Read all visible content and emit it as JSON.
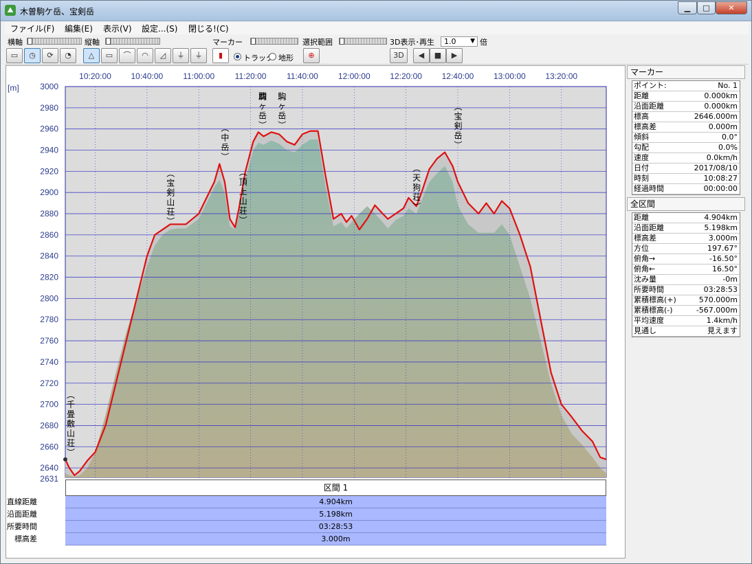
{
  "window": {
    "title": "木曽駒ケ岳、宝剣岳",
    "min": "▁",
    "max": "□",
    "close": "✕"
  },
  "menu": [
    "ファイル(F)",
    "編集(E)",
    "表示(V)",
    "設定...(S)",
    "閉じる!(C)"
  ],
  "toolbar": {
    "horizontal_label": "横軸",
    "vertical_label": "縦軸",
    "marker_label": "マーカー",
    "track_label": "トラック",
    "terrain_label": "地形",
    "selection_label": "選択範囲",
    "play3d_label": "3D表示･再生",
    "zoom_value": "1.0",
    "zoom_unit": "倍"
  },
  "chart_data": {
    "type": "area",
    "ylabel": "[m]",
    "ylim": [
      2631,
      3000
    ],
    "y_ticks": [
      3000,
      2980,
      2960,
      2940,
      2920,
      2900,
      2880,
      2860,
      2840,
      2820,
      2800,
      2780,
      2760,
      2740,
      2720,
      2700,
      2680,
      2660,
      2640,
      2631
    ],
    "x_ticks": [
      "10:20:00",
      "10:40:00",
      "11:00:00",
      "11:20:00",
      "11:40:00",
      "12:00:00",
      "12:20:00",
      "12:40:00",
      "13:00:00",
      "13:20:00"
    ],
    "xlim": [
      "10:08:27",
      "13:37:20"
    ],
    "series": [
      {
        "role": "track",
        "color": "#e01010",
        "x": [
          "10:08:27",
          "10:10:00",
          "10:12:00",
          "10:14:00",
          "10:17:00",
          "10:20:00",
          "10:24:00",
          "10:28:00",
          "10:32:00",
          "10:36:00",
          "10:40:00",
          "10:43:00",
          "10:46:00",
          "10:49:00",
          "10:52:00",
          "10:55:00",
          "11:00:00",
          "11:03:00",
          "11:06:00",
          "11:08:00",
          "11:10:00",
          "11:12:00",
          "11:14:00",
          "11:15:30",
          "11:18:00",
          "11:21:00",
          "11:23:00",
          "11:25:00",
          "11:28:00",
          "11:31:00",
          "11:34:00",
          "11:37:00",
          "11:40:00",
          "11:43:00",
          "11:46:00",
          "11:49:00",
          "11:52:00",
          "11:55:00",
          "11:57:00",
          "11:59:00",
          "12:02:00",
          "12:05:00",
          "12:08:00",
          "12:11:00",
          "12:13:00",
          "12:16:00",
          "12:19:00",
          "12:21:00",
          "12:24:00",
          "12:26:00",
          "12:29:00",
          "12:32:00",
          "12:35:00",
          "12:38:00",
          "12:40:00",
          "12:44:00",
          "12:48:00",
          "12:51:00",
          "12:54:00",
          "12:57:00",
          "13:00:00",
          "13:04:00",
          "13:08:00",
          "13:12:00",
          "13:16:00",
          "13:20:00",
          "13:24:00",
          "13:28:00",
          "13:32:00",
          "13:35:00",
          "13:37:20"
        ],
        "y": [
          2648,
          2640,
          2633,
          2637,
          2647,
          2655,
          2680,
          2720,
          2760,
          2800,
          2840,
          2860,
          2865,
          2870,
          2870,
          2870,
          2880,
          2895,
          2910,
          2927,
          2910,
          2875,
          2867,
          2885,
          2920,
          2948,
          2957,
          2953,
          2957,
          2955,
          2948,
          2945,
          2955,
          2958,
          2958,
          2915,
          2875,
          2880,
          2872,
          2878,
          2865,
          2875,
          2888,
          2880,
          2875,
          2880,
          2885,
          2895,
          2887,
          2900,
          2922,
          2932,
          2938,
          2925,
          2910,
          2890,
          2880,
          2890,
          2880,
          2892,
          2885,
          2860,
          2830,
          2780,
          2730,
          2700,
          2688,
          2675,
          2665,
          2650,
          2648
        ]
      },
      {
        "role": "terrain",
        "color": "#8fb8a8",
        "x": [
          "10:08:27",
          "10:10:00",
          "10:12:00",
          "10:14:00",
          "10:17:00",
          "10:20:00",
          "10:24:00",
          "10:28:00",
          "10:32:00",
          "10:36:00",
          "10:40:00",
          "10:43:00",
          "10:46:00",
          "10:49:00",
          "10:52:00",
          "10:55:00",
          "11:00:00",
          "11:03:00",
          "11:06:00",
          "11:08:00",
          "11:10:00",
          "11:12:00",
          "11:14:00",
          "11:15:30",
          "11:18:00",
          "11:21:00",
          "11:23:00",
          "11:25:00",
          "11:28:00",
          "11:31:00",
          "11:34:00",
          "11:37:00",
          "11:40:00",
          "11:43:00",
          "11:46:00",
          "11:49:00",
          "11:52:00",
          "11:55:00",
          "11:57:00",
          "11:59:00",
          "12:02:00",
          "12:05:00",
          "12:08:00",
          "12:11:00",
          "12:13:00",
          "12:16:00",
          "12:19:00",
          "12:21:00",
          "12:24:00",
          "12:26:00",
          "12:29:00",
          "12:32:00",
          "12:35:00",
          "12:38:00",
          "12:40:00",
          "12:44:00",
          "12:48:00",
          "12:51:00",
          "12:54:00",
          "12:57:00",
          "13:00:00",
          "13:04:00",
          "13:08:00",
          "13:12:00",
          "13:16:00",
          "13:20:00",
          "13:24:00",
          "13:28:00",
          "13:32:00",
          "13:35:00",
          "13:37:20"
        ],
        "y": [
          2635,
          2633,
          2632,
          2633,
          2640,
          2655,
          2690,
          2730,
          2768,
          2800,
          2830,
          2850,
          2860,
          2865,
          2866,
          2866,
          2875,
          2890,
          2905,
          2912,
          2900,
          2868,
          2865,
          2880,
          2912,
          2940,
          2947,
          2945,
          2949,
          2946,
          2940,
          2938,
          2945,
          2950,
          2950,
          2905,
          2868,
          2872,
          2866,
          2872,
          2880,
          2887,
          2880,
          2872,
          2866,
          2874,
          2878,
          2885,
          2880,
          2892,
          2910,
          2918,
          2925,
          2910,
          2888,
          2870,
          2862,
          2862,
          2862,
          2870,
          2860,
          2830,
          2800,
          2760,
          2720,
          2690,
          2672,
          2662,
          2650,
          2640,
          2635
        ]
      }
    ],
    "annotations": [
      {
        "text": "(千畳敷山荘)",
        "x": "10:08:27",
        "y": 2648
      },
      {
        "text": "(宝剣山荘)",
        "x": "10:47:00",
        "y": 2866
      },
      {
        "text": "(中岳)",
        "x": "11:08:00",
        "y": 2927
      },
      {
        "text": "(頂上山荘)",
        "x": "11:15:00",
        "y": 2867
      },
      {
        "text": "(西駒ヶ岳)",
        "x": "11:22:30",
        "y": 2957
      },
      {
        "text": "(駒ヶ岳)",
        "x": "11:30:00",
        "y": 2957
      },
      {
        "text": "(天狗荘)",
        "x": "12:22:00",
        "y": 2880
      },
      {
        "text": "(宝剣岳)",
        "x": "12:38:00",
        "y": 2938
      }
    ],
    "grid": true
  },
  "stats": {
    "header": "区間 1",
    "rows": [
      {
        "label": "直線距離",
        "value": "4.904km"
      },
      {
        "label": "沿面距離",
        "value": "5.198km"
      },
      {
        "label": "所要時間",
        "value": "03:28:53"
      },
      {
        "label": "標高差",
        "value": "3.000m"
      }
    ]
  },
  "marker_panel": {
    "title": "マーカー",
    "rows": [
      {
        "k": "ポイント:",
        "v": "No. 1"
      },
      {
        "k": "距離",
        "v": "0.000km"
      },
      {
        "k": "沿面距離",
        "v": "0.000km"
      },
      {
        "k": "標高",
        "v": "2646.000m"
      },
      {
        "k": "標高差",
        "v": "0.000m"
      },
      {
        "k": "傾斜",
        "v": "0.0°"
      },
      {
        "k": "勾配",
        "v": "0.0%"
      },
      {
        "k": "速度",
        "v": "0.0km/h"
      },
      {
        "k": "日付",
        "v": "2017/08/10"
      },
      {
        "k": "時刻",
        "v": "10:08:27"
      },
      {
        "k": "経過時間",
        "v": "00:00:00"
      }
    ]
  },
  "total_panel": {
    "title": "全区間",
    "rows": [
      {
        "k": "距離",
        "v": "4.904km"
      },
      {
        "k": "沿面距離",
        "v": "5.198km"
      },
      {
        "k": "標高差",
        "v": "3.000m"
      },
      {
        "k": "方位",
        "v": "197.67°"
      },
      {
        "k": "俯角→",
        "v": "-16.50°"
      },
      {
        "k": "俯角←",
        "v": "16.50°"
      },
      {
        "k": "沈み量",
        "v": "-0m"
      },
      {
        "k": "所要時間",
        "v": "03:28:53"
      },
      {
        "k": "累積標高(+)",
        "v": "570.000m"
      },
      {
        "k": "累積標高(-)",
        "v": "-567.000m"
      },
      {
        "k": "平均速度",
        "v": "1.4km/h"
      },
      {
        "k": "見通し",
        "v": "見えます"
      }
    ]
  }
}
